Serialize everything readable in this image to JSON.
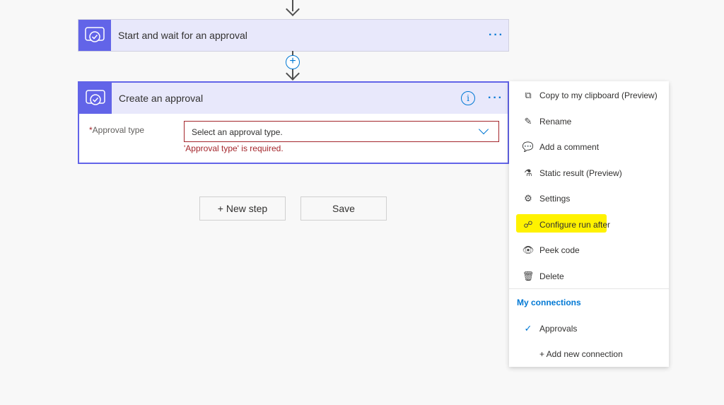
{
  "steps": [
    {
      "title": "Start and wait for an approval",
      "icon": "approval-icon"
    },
    {
      "title": "Create an approval",
      "icon": "approval-icon"
    }
  ],
  "create_approval": {
    "field_label": "Approval type",
    "required_marker": "*",
    "select_placeholder": "Select an approval type.",
    "error": "'Approval type' is required."
  },
  "buttons": {
    "new_step": "+ New step",
    "save": "Save",
    "insert": "+"
  },
  "menu": {
    "items": [
      {
        "label": "Copy to my clipboard (Preview)",
        "icon": "copy-icon"
      },
      {
        "label": "Rename",
        "icon": "pencil-icon"
      },
      {
        "label": "Add a comment",
        "icon": "comment-icon"
      },
      {
        "label": "Static result (Preview)",
        "icon": "flask-icon"
      },
      {
        "label": "Settings",
        "icon": "gear-icon"
      },
      {
        "label": "Configure run after",
        "icon": "run-after-icon",
        "highlighted": true
      },
      {
        "label": "Peek code",
        "icon": "eye-icon"
      },
      {
        "label": "Delete",
        "icon": "trash-icon"
      }
    ],
    "connections_header": "My connections",
    "connections": [
      {
        "label": "Approvals",
        "selected": true
      }
    ],
    "add_connection": "+ Add new connection"
  },
  "colors": {
    "accent": "#6264e8",
    "link": "#0078d4",
    "error": "#a4262c",
    "highlight": "#fff200"
  }
}
